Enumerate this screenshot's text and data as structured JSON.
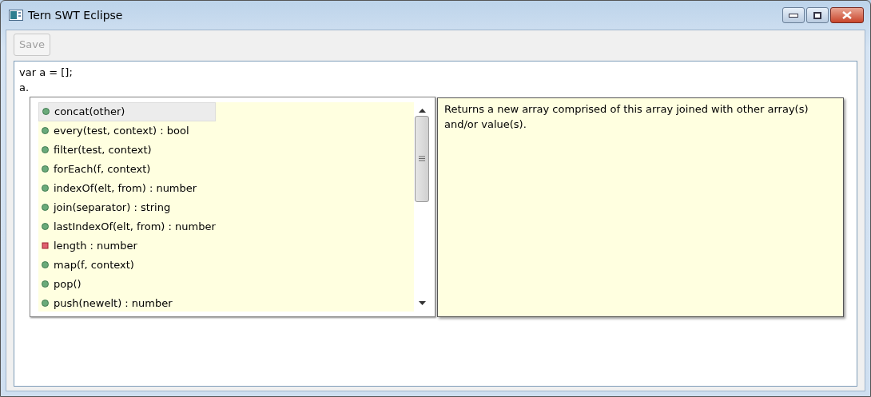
{
  "window": {
    "title": "Tern SWT Eclipse"
  },
  "toolbar": {
    "buttons": [
      {
        "label": "Save",
        "disabled": true
      }
    ]
  },
  "editor": {
    "lines": [
      "var a = [];",
      "a."
    ]
  },
  "completions": [
    {
      "label": "concat(other)",
      "kind": "method",
      "selected": true
    },
    {
      "label": "every(test, context) : bool",
      "kind": "method",
      "selected": false
    },
    {
      "label": "filter(test, context)",
      "kind": "method",
      "selected": false
    },
    {
      "label": "forEach(f, context)",
      "kind": "method",
      "selected": false
    },
    {
      "label": "indexOf(elt, from) : number",
      "kind": "method",
      "selected": false
    },
    {
      "label": "join(separator) : string",
      "kind": "method",
      "selected": false
    },
    {
      "label": "lastIndexOf(elt, from) : number",
      "kind": "method",
      "selected": false
    },
    {
      "label": "length : number",
      "kind": "property",
      "selected": false
    },
    {
      "label": "map(f, context)",
      "kind": "method",
      "selected": false
    },
    {
      "label": "pop()",
      "kind": "method",
      "selected": false
    },
    {
      "label": "push(newelt) : number",
      "kind": "method",
      "selected": false
    }
  ],
  "documentation": {
    "text": "Returns a new array comprised of this array joined with other array(s) and/or value(s)."
  }
}
